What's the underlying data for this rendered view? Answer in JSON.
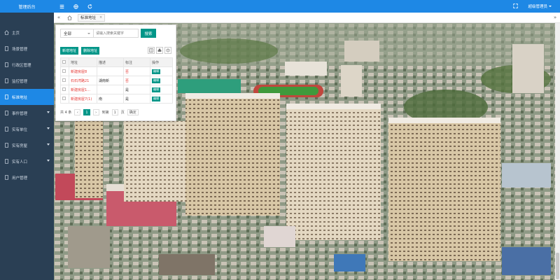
{
  "app": {
    "title": "管理后台"
  },
  "sidebar": {
    "items": [
      {
        "label": "主页",
        "icon": "home-icon",
        "active": false,
        "expandable": false
      },
      {
        "label": "场景管理",
        "icon": "document-icon",
        "active": false,
        "expandable": false
      },
      {
        "label": "行政区管理",
        "icon": "document-icon",
        "active": false,
        "expandable": false
      },
      {
        "label": "监控管理",
        "icon": "document-icon",
        "active": false,
        "expandable": false
      },
      {
        "label": "标准地址",
        "icon": "document-icon",
        "active": true,
        "expandable": false
      },
      {
        "label": "事件管理",
        "icon": "document-icon",
        "active": false,
        "expandable": true
      },
      {
        "label": "实有单位",
        "icon": "document-icon",
        "active": false,
        "expandable": true
      },
      {
        "label": "实有房屋",
        "icon": "document-icon",
        "active": false,
        "expandable": true
      },
      {
        "label": "实有人口",
        "icon": "document-icon",
        "active": false,
        "expandable": true
      },
      {
        "label": "用户管理",
        "icon": "document-icon",
        "active": false,
        "expandable": false
      }
    ]
  },
  "topbar": {
    "icons": [
      "menu-icon",
      "globe-icon",
      "refresh-icon"
    ],
    "right_icon": "fullscreen-icon",
    "user_label": "超级管理员"
  },
  "tabs": {
    "items": [
      {
        "label": "标准地址"
      }
    ],
    "close_glyph": "×",
    "left_arrow": "«",
    "right_arrow": "»"
  },
  "panel": {
    "select_value": "全部",
    "search_placeholder": "请输入搜索关键字",
    "search_button": "搜索",
    "add_button": "新增地址",
    "delete_button": "删除地址",
    "tool_icons": [
      "columns-icon",
      "print-icon",
      "export-icon"
    ],
    "table": {
      "headers": [
        "地址",
        "描述",
        "标注",
        "操作"
      ],
      "rows": [
        {
          "address": "新建房屋8",
          "desc": "",
          "mark": "否",
          "mark_red": true,
          "action": "编辑"
        },
        {
          "address": "石石湾路21",
          "desc": "湖南新",
          "mark": "否",
          "mark_red": true,
          "action": "编辑"
        },
        {
          "address": "新建房屋1...",
          "desc": "",
          "mark": "是",
          "mark_red": false,
          "action": "编辑"
        },
        {
          "address": "新建房屋7(1)",
          "desc": "南",
          "mark": "是",
          "mark_red": false,
          "action": "编辑"
        }
      ]
    },
    "pager": {
      "total": "共 4 条",
      "current": "1",
      "goto_prefix": "到第",
      "goto_value": "1",
      "goto_suffix": "页",
      "confirm": "确定"
    }
  },
  "colors": {
    "primary": "#1e88e5",
    "sidebar": "#2a3f54",
    "accent": "#009688",
    "danger": "#e53935"
  }
}
